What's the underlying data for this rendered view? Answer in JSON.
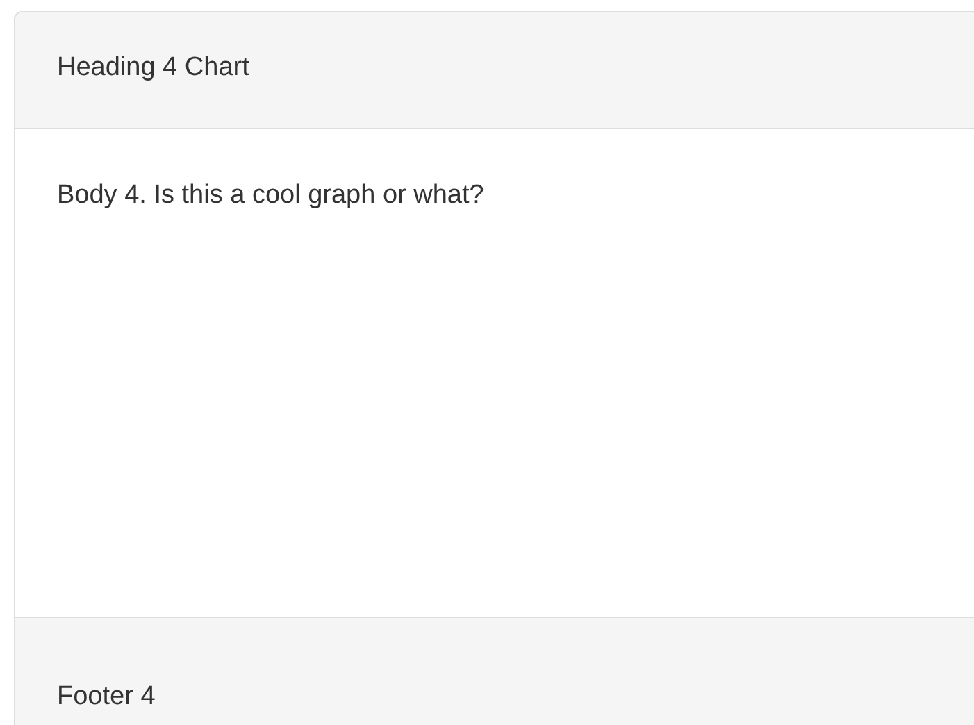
{
  "panel": {
    "heading": "Heading 4 Chart",
    "body": "Body 4. Is this a cool graph or what?",
    "footer": "Footer 4"
  }
}
